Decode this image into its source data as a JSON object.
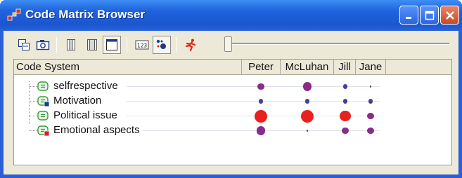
{
  "window": {
    "title": "Code Matrix Browser"
  },
  "toolbar": {
    "tools": [
      {
        "icon": "copy-icon"
      },
      {
        "icon": "camera-icon"
      },
      {
        "icon": "column-narrow-icon"
      },
      {
        "icon": "column-medium-icon"
      },
      {
        "icon": "column-wide-icon"
      },
      {
        "icon": "numbers-123-icon"
      },
      {
        "icon": "symbols-dots-icon"
      },
      {
        "icon": "running-figure-icon"
      }
    ],
    "slider_value": 0
  },
  "matrix": {
    "header_codesystem": "Code System",
    "columns": [
      "Peter",
      "McLuhan",
      "Jill",
      "Jane"
    ],
    "rows": [
      {
        "label": "selfrespective",
        "icon": "code-icon",
        "icon_color": "#3a9a3a",
        "values": [
          2,
          3,
          1,
          0.5
        ]
      },
      {
        "label": "Motivation",
        "icon": "code-memo-icon",
        "icon_color": "#3a9a3a",
        "values": [
          1,
          1,
          1,
          1
        ]
      },
      {
        "label": "Political issue",
        "icon": "code-icon",
        "icon_color": "#3a9a3a",
        "values": [
          5,
          6,
          4,
          2
        ]
      },
      {
        "label": "Emotional aspects",
        "icon": "code-memo-icon",
        "icon_color": "#3a9a3a",
        "values": [
          3,
          0.5,
          2,
          2
        ]
      }
    ],
    "colors": {
      "high": "#e8201e",
      "mid": "#8a2a8a",
      "low": "#4a3aa0"
    }
  }
}
